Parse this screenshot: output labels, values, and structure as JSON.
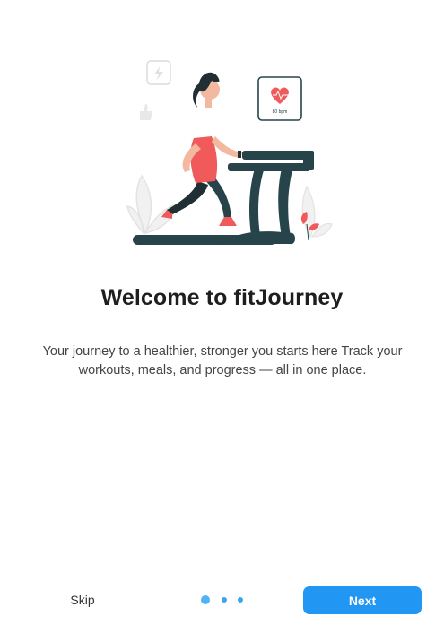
{
  "onboarding": {
    "title": "Welcome to fitJourney",
    "description": "Your journey to a healthier, stronger you starts here Track your workouts, meals, and progress — all in one place.",
    "illustration": {
      "icon": "woman-running-on-treadmill-illustration",
      "heart_card_text": "80 bpm"
    }
  },
  "footer": {
    "skip_label": "Skip",
    "next_label": "Next",
    "page_indicator": {
      "total": 3,
      "current": 1
    }
  },
  "colors": {
    "accent": "#2196f3",
    "dot_active": "#4fb3f5",
    "shirt": "#f05a5a",
    "treadmill": "#26444a"
  }
}
